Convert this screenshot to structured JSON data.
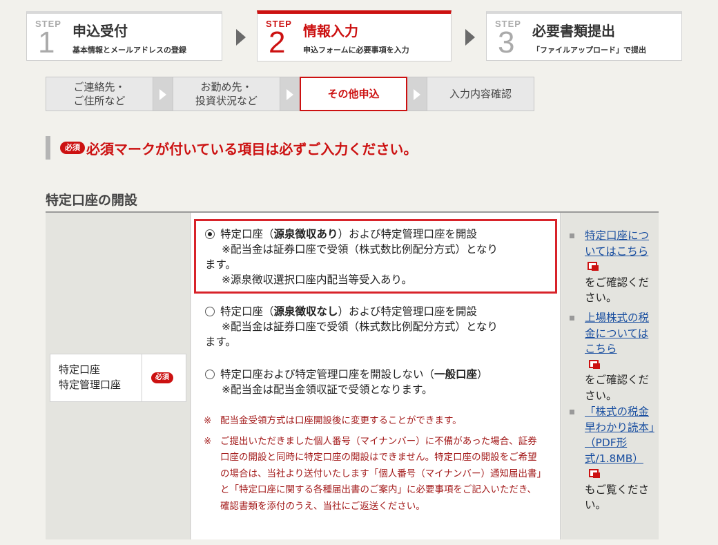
{
  "steps": [
    {
      "word": "STEP",
      "num": "1",
      "title": "申込受付",
      "sub": "基本情報とメールアドレスの登録"
    },
    {
      "word": "STEP",
      "num": "2",
      "title": "情報入力",
      "sub": "申込フォームに必要事項を入力"
    },
    {
      "word": "STEP",
      "num": "3",
      "title": "必要書類提出",
      "sub": "「ファイルアップロード」で提出"
    }
  ],
  "subtabs": [
    {
      "label": "ご連絡先・\nご住所など"
    },
    {
      "label": "お勤め先・\n投資状況など"
    },
    {
      "label": "その他申込"
    },
    {
      "label": "入力内容確認"
    }
  ],
  "notice": {
    "badge": "必須",
    "text": "必須マークが付いている項目は必ずご入力ください。"
  },
  "section": {
    "title": "特定口座の開設"
  },
  "field": {
    "label1": "特定口座",
    "label2": "特定管理口座",
    "badge": "必須"
  },
  "options": [
    {
      "pre": "特定口座（",
      "bold": "源泉徴収あり",
      "post": "）および特定管理口座を開設",
      "l2": "※配当金は証券口座で受領（株式数比例配分方式）となり",
      "l3": "ます。",
      "l4": "※源泉徴収選択口座内配当等受入あり。",
      "selected": true
    },
    {
      "pre": "特定口座（",
      "bold": "源泉徴収なし",
      "post": "）および特定管理口座を開設",
      "l2": "※配当金は証券口座で受領（株式数比例配分方式）となり",
      "l3": "ます。",
      "selected": false
    },
    {
      "pre": "特定口座および特定管理口座を開設しない（",
      "bold": "一般口座",
      "post": "）",
      "l2": "※配当金は配当金領収証で受領となります。",
      "selected": false
    }
  ],
  "notes": [
    {
      "mark": "※",
      "text": "配当金受領方式は口座開設後に変更することができます。"
    },
    {
      "mark": "※",
      "text": "ご提出いただきました個人番号（マイナンバー）に不備があった場合、証券口座の開設と同時に特定口座の開設はできません。特定口座の開設をご希望の場合は、当社より送付いたします「個人番号（マイナンバー）通知届出書」と「特定口座に関する各種届出書のご案内」に必要事項をご記入いただき、確認書類を添付のうえ、当社にご返送ください。"
    }
  ],
  "side": [
    {
      "link": "特定口座についてはこちら",
      "after": "をご確認ください。"
    },
    {
      "link": "上場株式の税金についてはこちら",
      "after": "をご確認ください。"
    },
    {
      "link": "「株式の税金早わかり読本」（PDF形式/1.8MB）",
      "after": "もご覧ください。"
    }
  ],
  "colors": {
    "accent": "#cc1111",
    "link": "#1a4fa0",
    "highlight": "#d8232a"
  }
}
